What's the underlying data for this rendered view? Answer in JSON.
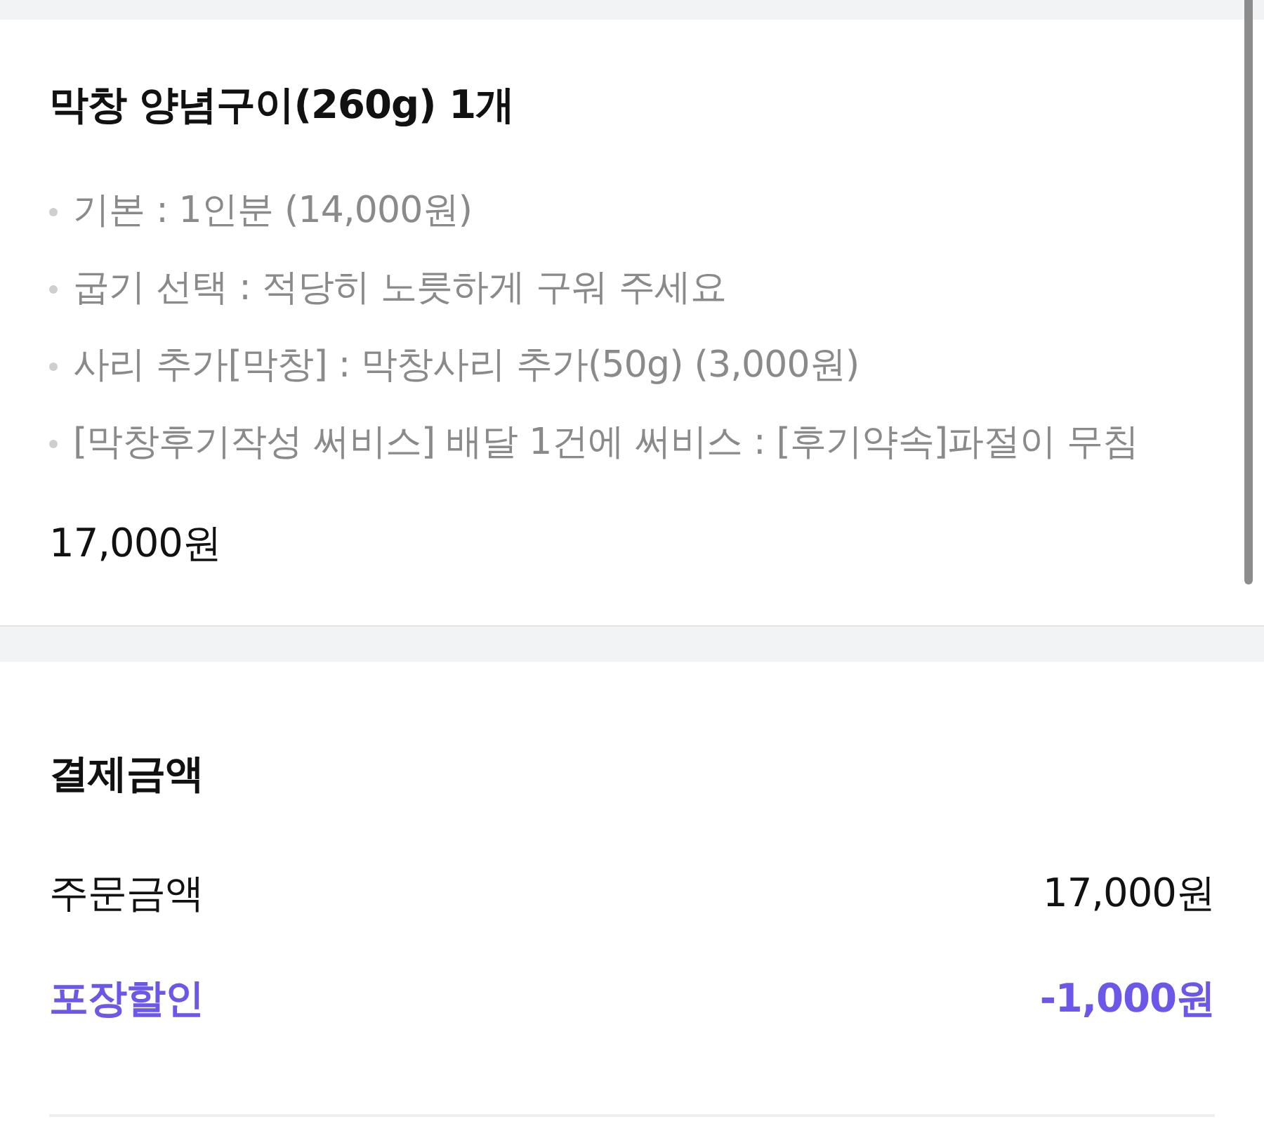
{
  "item_card": {
    "title": "막창 양념구이(260g) 1개",
    "options": [
      "기본 : 1인분 (14,000원)",
      "굽기 선택 : 적당히 노릇하게 구워 주세요",
      "사리 추가[막창] : 막창사리 추가(50g) (3,000원)",
      "[막창후기작성 써비스] 배달 1건에 써비스 : [후기약속]파절이 무침"
    ],
    "price": "17,000원"
  },
  "payment": {
    "title": "결제금액",
    "rows": [
      {
        "kind": "normal",
        "label": "주문금액",
        "amount": "17,000원"
      },
      {
        "kind": "discount",
        "label": "포장할인",
        "amount": "-1,000원"
      }
    ]
  }
}
